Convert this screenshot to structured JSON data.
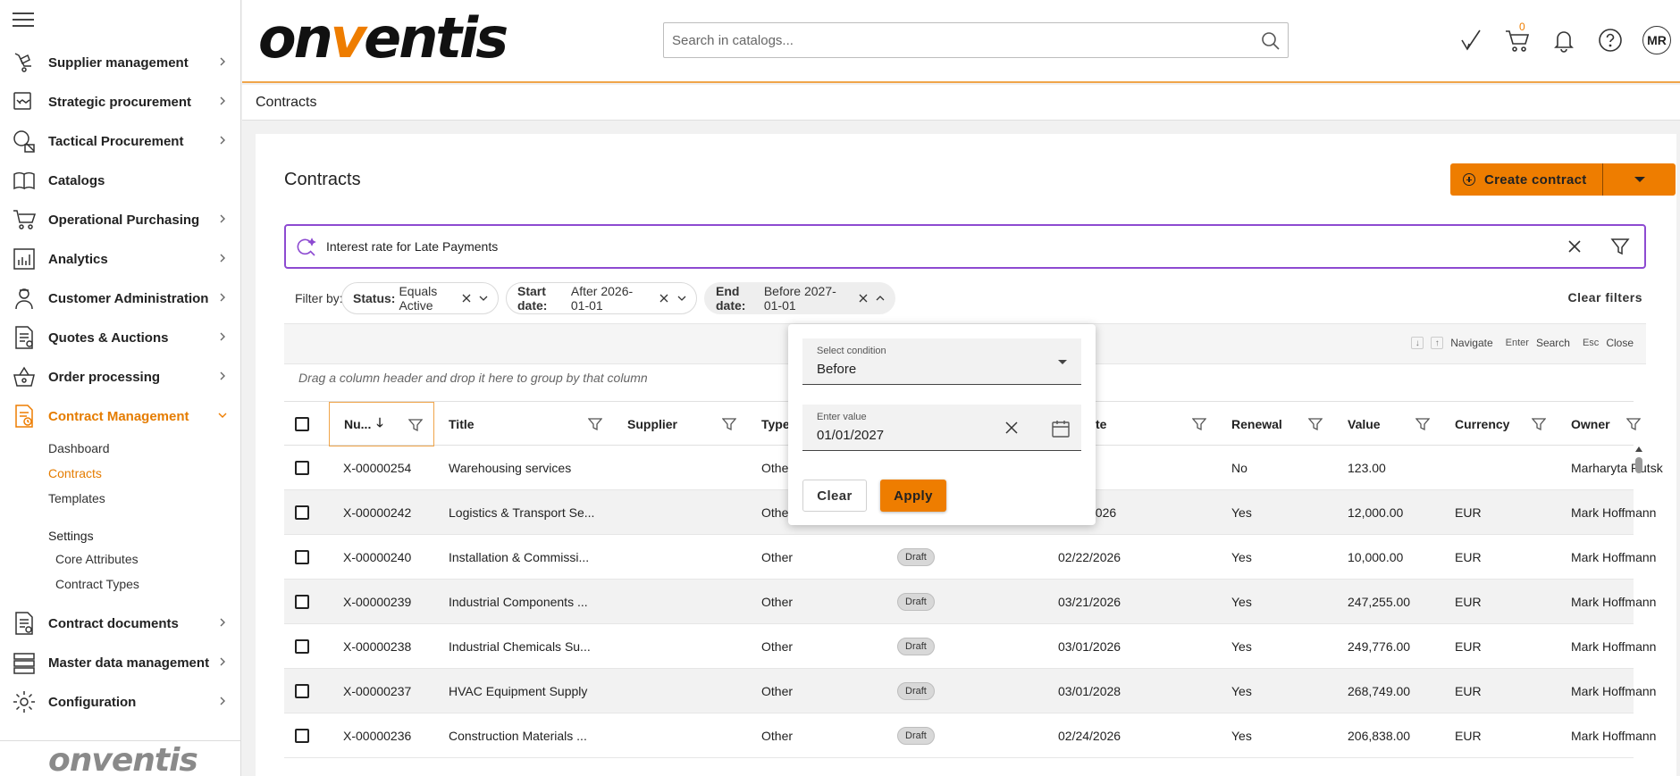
{
  "sidebar": {
    "items": [
      {
        "label": "Supplier management",
        "icon": "supplier-icon",
        "chevron": true
      },
      {
        "label": "Strategic procurement",
        "icon": "handshake-icon",
        "chevron": true
      },
      {
        "label": "Tactical Procurement",
        "icon": "magnifier-box-icon",
        "chevron": true
      },
      {
        "label": "Catalogs",
        "icon": "book-icon",
        "chevron": false
      },
      {
        "label": "Operational Purchasing",
        "icon": "cart-icon",
        "chevron": true
      },
      {
        "label": "Analytics",
        "icon": "bar-chart-icon",
        "chevron": true
      },
      {
        "label": "Customer Administration",
        "icon": "person-icon",
        "chevron": true
      },
      {
        "label": "Quotes & Auctions",
        "icon": "quote-doc-icon",
        "chevron": true
      },
      {
        "label": "Order processing",
        "icon": "basket-icon",
        "chevron": true
      },
      {
        "label": "Contract Management",
        "icon": "contract-icon",
        "chevron": true
      }
    ],
    "contract_sub": {
      "dashboard": "Dashboard",
      "contracts": "Contracts",
      "templates": "Templates",
      "settings": "Settings",
      "core_attributes": "Core Attributes",
      "contract_types": "Contract Types"
    },
    "bottom_items": [
      {
        "label": "Contract documents",
        "icon": "document-icon"
      },
      {
        "label": "Master data management",
        "icon": "database-icon"
      },
      {
        "label": "Configuration",
        "icon": "gear-icon"
      }
    ],
    "footer_logo": "onventis"
  },
  "header": {
    "logo_pre": "on",
    "logo_v": "v",
    "logo_post": "entis",
    "search_placeholder": "Search in catalogs...",
    "cart_count": "0",
    "avatar": "MR",
    "accent": "#ee7d00"
  },
  "breadcrumb": "Contracts",
  "page": {
    "title": "Contracts",
    "create_label": "Create contract",
    "query": "Interest rate for Late Payments",
    "filter_by": "Filter by:",
    "filters": [
      {
        "key": "Status:",
        "value": "Equals Active"
      },
      {
        "key": "Start date:",
        "value": "After 2026-01-01"
      },
      {
        "key": "End date:",
        "value": "Before 2027-01-01"
      }
    ],
    "clear_filters": "Clear filters",
    "hints": {
      "navigate": "Navigate",
      "enter": "Enter",
      "search": "Search",
      "esc": "Esc",
      "close": "Close"
    },
    "group_hint": "Drag a column header and drop it here to group by that column"
  },
  "table": {
    "columns": {
      "number": "Nu...",
      "title": "Title",
      "supplier": "Supplier",
      "type": "Type",
      "end_date": "te",
      "renewal": "Renewal",
      "value": "Value",
      "currency": "Currency",
      "owner": "Owner"
    },
    "rows": [
      {
        "number": "X-00000254",
        "title": "Warehousing services",
        "type": "Other",
        "status": "",
        "date": "",
        "renewal": "No",
        "value": "123.00",
        "currency": "",
        "owner": "Marharyta Rutsk"
      },
      {
        "number": "X-00000242",
        "title": "Logistics & Transport Se...",
        "type": "Othe",
        "status": "",
        "date": "2026",
        "renewal": "Yes",
        "value": "12,000.00",
        "currency": "EUR",
        "owner": "Mark Hoffmann"
      },
      {
        "number": "X-00000240",
        "title": "Installation & Commissi...",
        "type": "Other",
        "status": "Draft",
        "date": "02/22/2026",
        "renewal": "Yes",
        "value": "10,000.00",
        "currency": "EUR",
        "owner": "Mark Hoffmann"
      },
      {
        "number": "X-00000239",
        "title": "Industrial Components ...",
        "type": "Other",
        "status": "Draft",
        "date": "03/21/2026",
        "renewal": "Yes",
        "value": "247,255.00",
        "currency": "EUR",
        "owner": "Mark Hoffmann"
      },
      {
        "number": "X-00000238",
        "title": "Industrial Chemicals Su...",
        "type": "Other",
        "status": "Draft",
        "date": "03/01/2026",
        "renewal": "Yes",
        "value": "249,776.00",
        "currency": "EUR",
        "owner": "Mark Hoffmann"
      },
      {
        "number": "X-00000237",
        "title": "HVAC Equipment Supply",
        "type": "Other",
        "status": "Draft",
        "date": "03/01/2028",
        "renewal": "Yes",
        "value": "268,749.00",
        "currency": "EUR",
        "owner": "Mark Hoffmann"
      },
      {
        "number": "X-00000236",
        "title": "Construction Materials ...",
        "type": "Other",
        "status": "Draft",
        "date": "02/24/2026",
        "renewal": "Yes",
        "value": "206,838.00",
        "currency": "EUR",
        "owner": "Mark Hoffmann"
      }
    ]
  },
  "popup": {
    "condition_label": "Select condition",
    "condition_value": "Before",
    "value_label": "Enter value",
    "value": "01/01/2027",
    "clear": "Clear",
    "apply": "Apply"
  }
}
